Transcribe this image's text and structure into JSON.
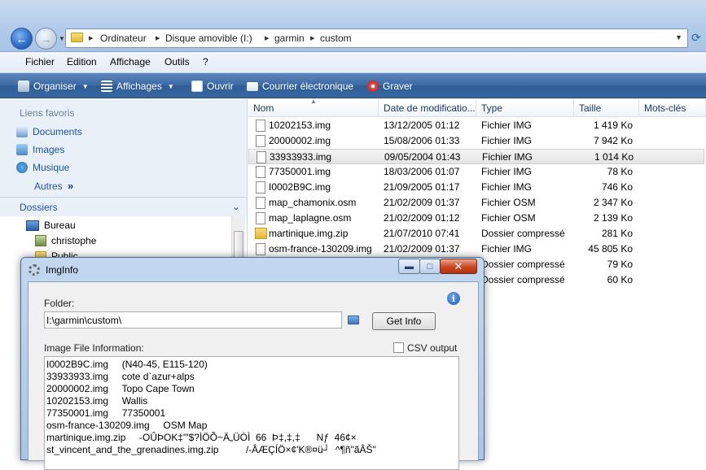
{
  "address_bar": {
    "crumbs": [
      "Ordinateur",
      "Disque amovible (I:)",
      "garmin",
      "custom"
    ]
  },
  "menu": [
    "Fichier",
    "Edition",
    "Affichage",
    "Outils",
    "?"
  ],
  "toolbar": {
    "organize": "Organiser",
    "views": "Affichages",
    "open": "Ouvrir",
    "email": "Courrier électronique",
    "burn": "Graver"
  },
  "nav_pane": {
    "favorites_header": "Liens favoris",
    "favorites": [
      "Documents",
      "Images",
      "Musique"
    ],
    "more": "Autres",
    "folders_header": "Dossiers",
    "tree": [
      "Bureau",
      "christophe",
      "Public"
    ]
  },
  "file_list": {
    "columns": [
      "Nom",
      "Date de modificatio...",
      "Type",
      "Taille",
      "Mots-clés"
    ],
    "rows": [
      {
        "name": "10202153.img",
        "date": "13/12/2005 01:12",
        "type": "Fichier IMG",
        "size": "1 419 Ko",
        "kind": "file",
        "selected": false
      },
      {
        "name": "20000002.img",
        "date": "15/08/2006 01:33",
        "type": "Fichier IMG",
        "size": "7 942 Ko",
        "kind": "file",
        "selected": false
      },
      {
        "name": "33933933.img",
        "date": "09/05/2004 01:43",
        "type": "Fichier IMG",
        "size": "1 014 Ko",
        "kind": "file",
        "selected": true
      },
      {
        "name": "77350001.img",
        "date": "18/03/2006 01:07",
        "type": "Fichier IMG",
        "size": "78 Ko",
        "kind": "file",
        "selected": false
      },
      {
        "name": "I0002B9C.img",
        "date": "21/09/2005 01:17",
        "type": "Fichier IMG",
        "size": "746 Ko",
        "kind": "file",
        "selected": false
      },
      {
        "name": "map_chamonix.osm",
        "date": "21/02/2009 01:37",
        "type": "Fichier OSM",
        "size": "2 347 Ko",
        "kind": "file",
        "selected": false
      },
      {
        "name": "map_laplagne.osm",
        "date": "21/02/2009 01:12",
        "type": "Fichier OSM",
        "size": "2 139 Ko",
        "kind": "file",
        "selected": false
      },
      {
        "name": "martinique.img.zip",
        "date": "21/07/2010 07:41",
        "type": "Dossier compressé",
        "size": "281 Ko",
        "kind": "zip",
        "selected": false
      },
      {
        "name": "osm-france-130209.img",
        "date": "21/02/2009 01:37",
        "type": "Fichier IMG",
        "size": "45 805 Ko",
        "kind": "file",
        "selected": false
      },
      {
        "name": "",
        "date": "",
        "type": "Dossier compressé",
        "size": "79 Ko",
        "kind": "zip",
        "selected": false
      },
      {
        "name": "",
        "date": "",
        "type": "Dossier compressé",
        "size": "60 Ko",
        "kind": "zip",
        "selected": false
      }
    ]
  },
  "dialog": {
    "title": "ImgInfo",
    "folder_label": "Folder:",
    "folder_value": "I:\\garmin\\custom\\",
    "get_info": "Get Info",
    "info_label": "Image File Information:",
    "csv_label": "CSV output",
    "csv_checked": false,
    "output_lines": [
      "I0002B9C.img     (N40-45, E115-120)",
      "33933933.img     cote d`azur+alps",
      "20000002.img     Topo Cape Town",
      "10202153.img     Wallis",
      "77350001.img     77350001",
      "osm-france-130209.img     OSM Map",
      "martinique.img.zip     -OÛÞOK‡\"'$?ÌÖÕ~Ä„ÜÒÌ  66  Þ‡,‡,‡      Nƒ  46¢×",
      "st_vincent_and_the_grenadines.img.zip          /-ÂÆÇÍÖ×¢'K®¤ü┘  ^¶ñ\"ãÂŠ\""
    ]
  }
}
